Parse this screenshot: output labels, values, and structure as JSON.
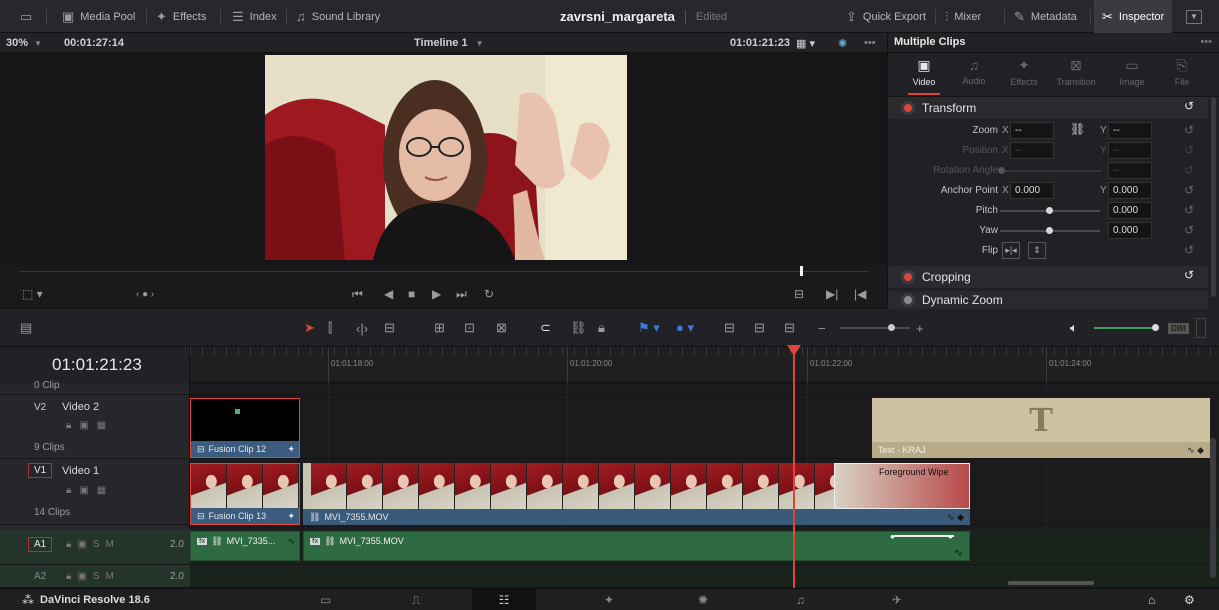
{
  "topbar": {
    "media_pool": "Media Pool",
    "effects": "Effects",
    "index": "Index",
    "sound_library": "Sound Library",
    "project_name": "zavrsni_margareta",
    "project_state": "Edited",
    "quick_export": "Quick Export",
    "mixer": "Mixer",
    "metadata": "Metadata",
    "inspector": "Inspector"
  },
  "viewer": {
    "zoom": "30%",
    "duration": "00:01:27:14",
    "timeline_name": "Timeline 1",
    "timecode": "01:01:21:23",
    "scrubber_position": 0.92
  },
  "inspector": {
    "title": "Multiple Clips",
    "tabs": [
      {
        "label": "Video",
        "active": true
      },
      {
        "label": "Audio",
        "active": false
      },
      {
        "label": "Effects",
        "active": false
      },
      {
        "label": "Transition",
        "active": false
      },
      {
        "label": "Image",
        "active": false
      },
      {
        "label": "File",
        "active": false
      }
    ],
    "transform": {
      "header": "Transform",
      "zoom_label": "Zoom",
      "zoom_x": "--",
      "zoom_y": "--",
      "position_label": "Position",
      "position_x": "--",
      "position_y": "--",
      "rotation_label": "Rotation Angle",
      "rotation_value": "--",
      "anchor_label": "Anchor Point",
      "anchor_x": "0.000",
      "anchor_y": "0.000",
      "pitch_label": "Pitch",
      "pitch_value": "0.000",
      "yaw_label": "Yaw",
      "yaw_value": "0.000",
      "flip_label": "Flip",
      "x_axis": "X",
      "y_axis": "Y"
    },
    "cropping_header": "Cropping",
    "dynamic_zoom_header": "Dynamic Zoom"
  },
  "timeline": {
    "timecode": "01:01:21:23",
    "ruler_labels": [
      "01:01:18:00",
      "01:01:20:00",
      "01:01:22:00",
      "01:01:24:00"
    ],
    "tracks": {
      "top_partial": "0 Clip",
      "v2": {
        "badge": "V2",
        "name": "Video 2",
        "clips": "9 Clips"
      },
      "v1": {
        "badge": "V1",
        "name": "Video 1",
        "clips": "14 Clips"
      },
      "a1": {
        "badge": "A1",
        "level": "2.0"
      },
      "a2": {
        "badge": "A2",
        "level": "2.0"
      }
    },
    "clips": {
      "fusion12": "Fusion Clip 12",
      "text_kraj": "Text - KRAJ",
      "text_glyph": "T",
      "fusion13": "Fusion Clip 13",
      "mvi": "MVI_7355.MOV",
      "foreground_wipe": "Foreground Wipe",
      "audio1": "MVI_7335...",
      "audio2": "MVI_7355.MOV"
    },
    "audio_meter": "DIM"
  },
  "pagebar": {
    "app_name": "DaVinci Resolve 18.6"
  }
}
